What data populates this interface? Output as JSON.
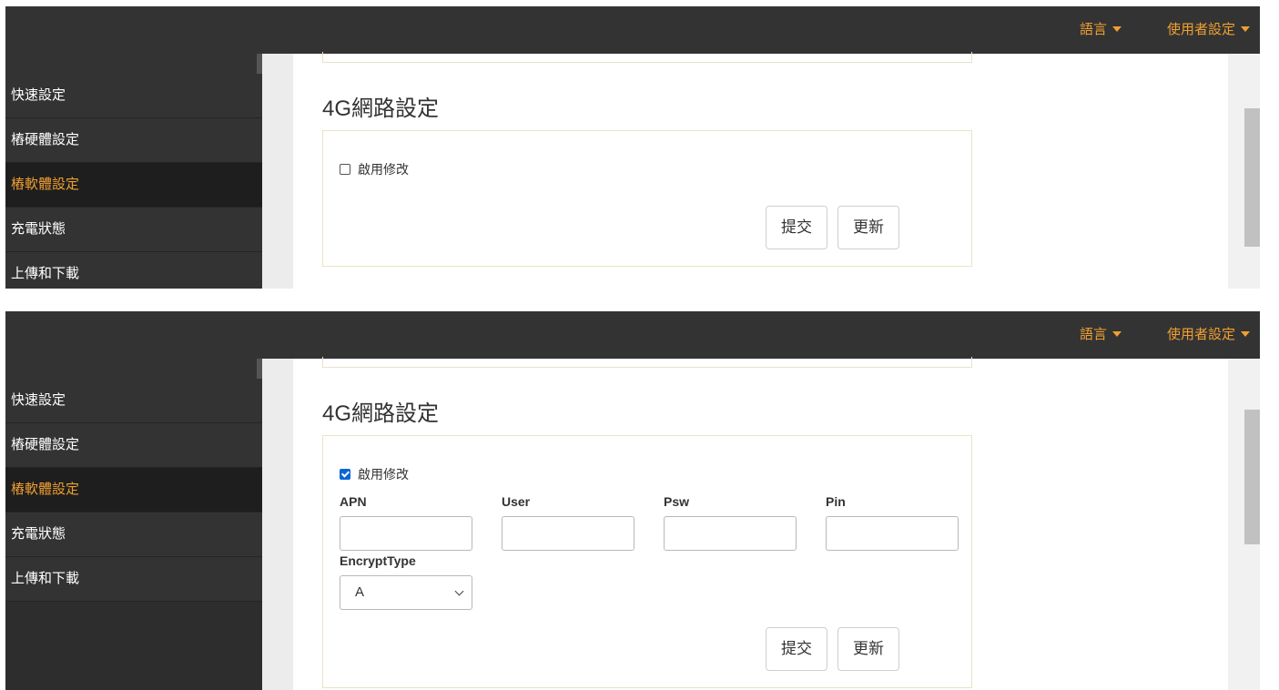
{
  "topbar": {
    "language_label": "語言",
    "user_settings_label": "使用者設定"
  },
  "sidebar": {
    "items": [
      {
        "label": "快速設定"
      },
      {
        "label": "樁硬體設定"
      },
      {
        "label": "樁軟體設定",
        "active": true
      },
      {
        "label": "充電狀態"
      },
      {
        "label": "上傳和下載"
      }
    ]
  },
  "section": {
    "title": "4G網路設定",
    "enable_edit_label": "啟用修改",
    "submit_label": "提交",
    "refresh_label": "更新"
  },
  "state_unchecked": {
    "enable_edit_checked": false
  },
  "state_checked": {
    "enable_edit_checked": true,
    "fields": [
      {
        "label": "APN",
        "value": ""
      },
      {
        "label": "User",
        "value": ""
      },
      {
        "label": "Psw",
        "value": ""
      },
      {
        "label": "Pin",
        "value": ""
      }
    ],
    "encrypt_type_label": "EncryptType",
    "encrypt_type_value": "A"
  },
  "colors": {
    "topbar_bg": "#333333",
    "accent": "#f0a030",
    "sidebar_bg": "#333333",
    "sidebar_active_bg": "#1e1e1e",
    "checkbox_checked": "#0a66d6"
  }
}
